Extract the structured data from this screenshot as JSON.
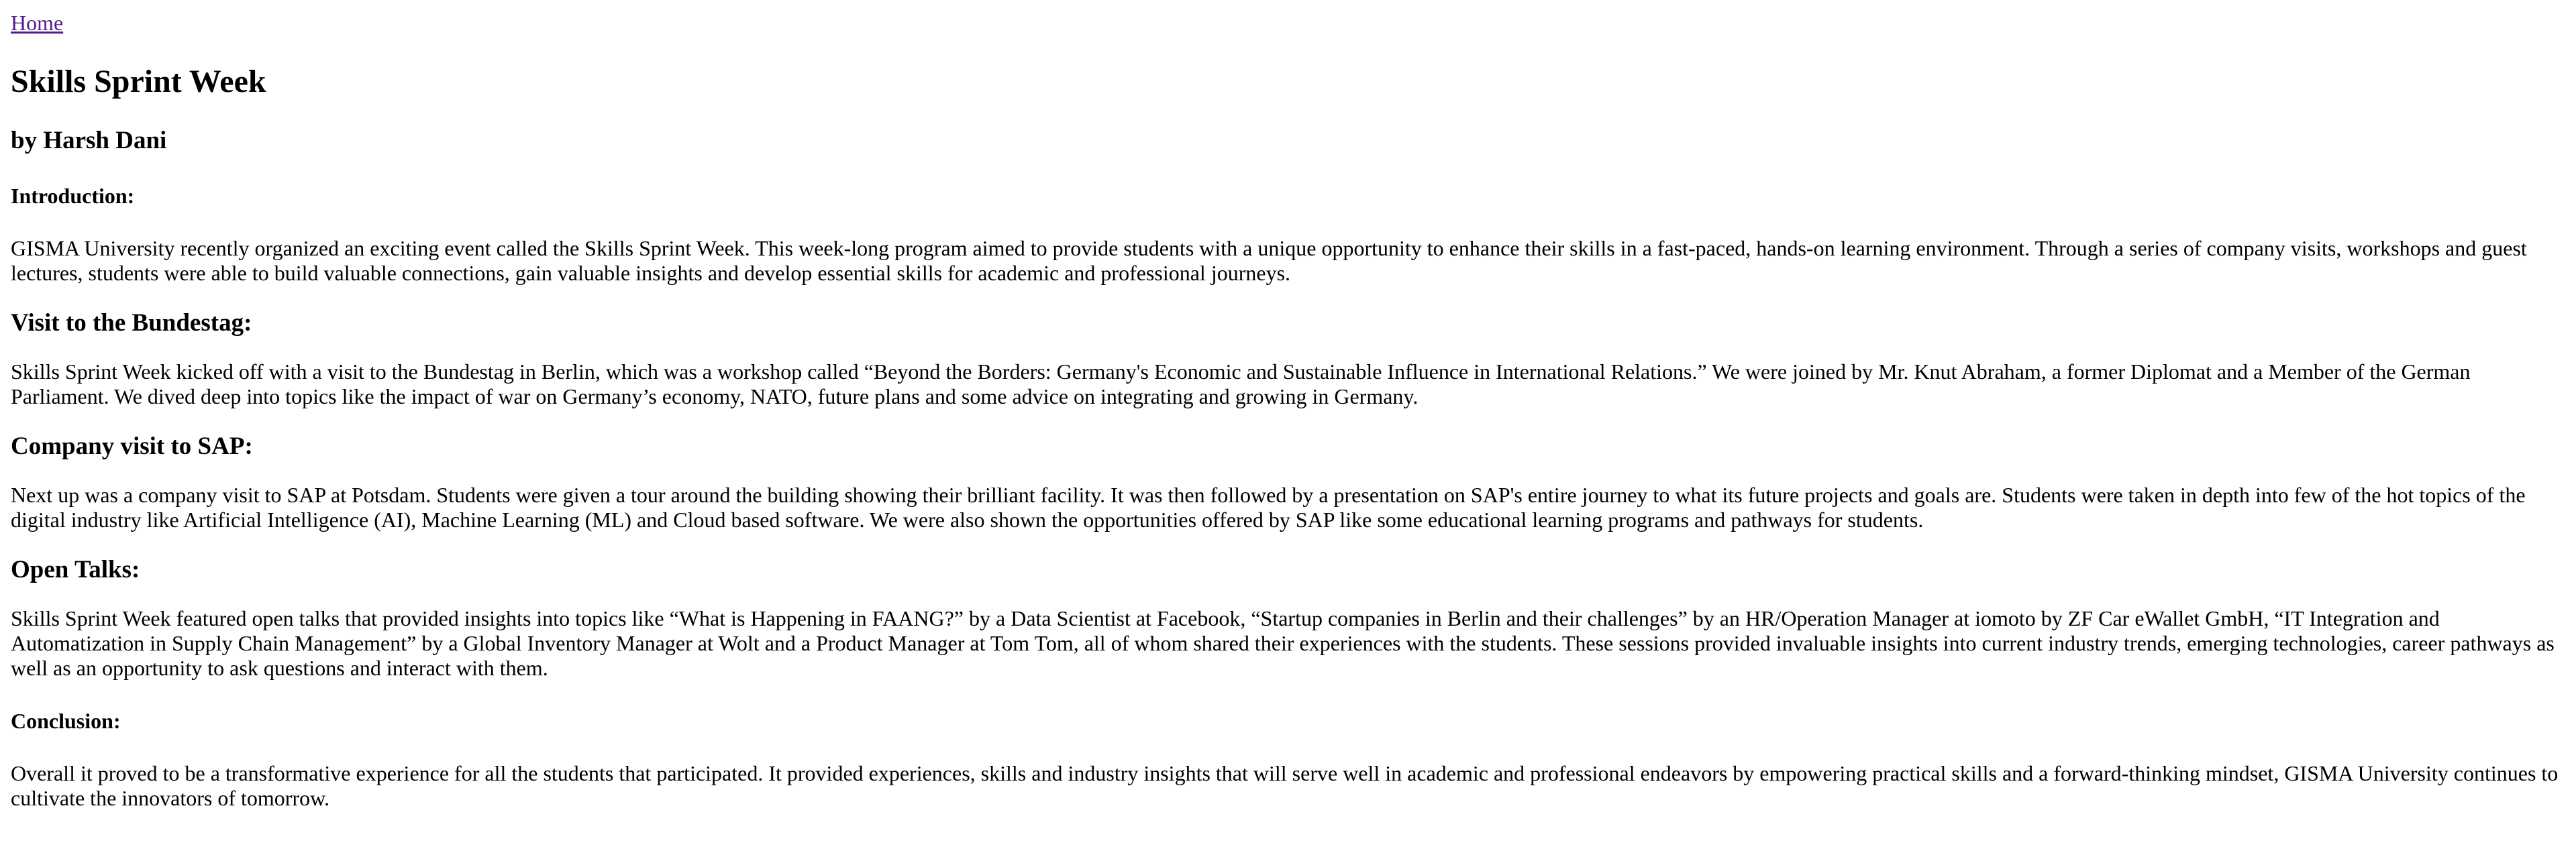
{
  "nav": {
    "home_label": "Home"
  },
  "article": {
    "title": "Skills Sprint Week",
    "byline": "by Harsh Dani",
    "sections": [
      {
        "heading": "Introduction:",
        "body": "GISMA University recently organized an exciting event called the Skills Sprint Week. This week-long program aimed to provide students with a unique opportunity to enhance their skills in a fast-paced, hands-on learning environment. Through a series of company visits, workshops and guest lectures, students were able to build valuable connections, gain valuable insights and develop essential skills for academic and professional journeys."
      },
      {
        "heading": "Visit to the Bundestag:",
        "body": "Skills Sprint Week kicked off with a visit to the Bundestag in Berlin, which was a workshop called “Beyond the Borders: Germany's Economic and Sustainable Influence in International Relations.” We were joined by Mr. Knut Abraham, a former Diplomat and a Member of the German Parliament. We dived deep into topics like the impact of war on Germany’s economy, NATO, future plans and some advice on integrating and growing in Germany."
      },
      {
        "heading": "Company visit to SAP:",
        "body": "Next up was a company visit to SAP at Potsdam. Students were given a tour around the building showing their brilliant facility. It was then followed by a presentation on SAP's entire journey to what its future projects and goals are. Students were taken in depth into few of the hot topics of the digital industry like Artificial Intelligence (AI), Machine Learning (ML) and Cloud based software. We were also shown the opportunities offered by SAP like some educational learning programs and pathways for students."
      },
      {
        "heading": "Open Talks:",
        "body": "Skills Sprint Week featured open talks that provided insights into topics like “What is Happening in FAANG?” by a Data Scientist at Facebook, “Startup companies in Berlin and their challenges” by an HR/Operation Manager at iomoto by ZF Car eWallet GmbH, “IT Integration and Automatization in Supply Chain Management” by a Global Inventory Manager at Wolt and a Product Manager at Tom Tom, all of whom shared their experiences with the students. These sessions provided invaluable insights into current industry trends, emerging technologies, career pathways as well as an opportunity to ask questions and interact with them."
      },
      {
        "heading": "Conclusion:",
        "body": "Overall it proved to be a transformative experience for all the students that participated. It provided experiences, skills and industry insights that will serve well in academic and professional endeavors by empowering practical skills and a forward-thinking mindset, GISMA University continues to cultivate the innovators of tomorrow."
      }
    ]
  }
}
